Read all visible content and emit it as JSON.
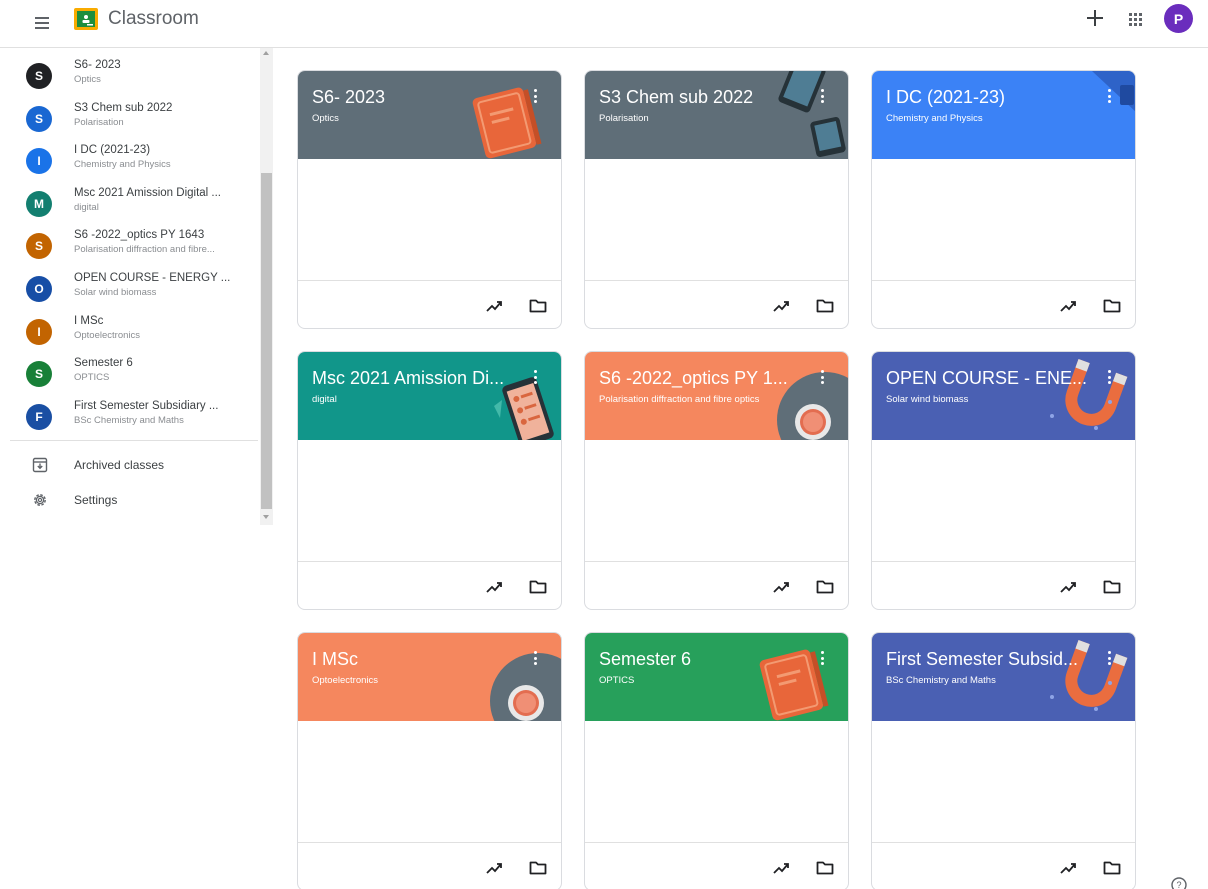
{
  "header": {
    "title": "Classroom",
    "avatar_letter": "P",
    "avatar_color": "#6a2dbd"
  },
  "sidebar": {
    "items": [
      {
        "initial": "S",
        "name": "S6- 2023",
        "subtitle": "Optics",
        "color": "#202124"
      },
      {
        "initial": "S",
        "name": "S3 Chem sub 2022",
        "subtitle": "Polarisation",
        "color": "#1967d2"
      },
      {
        "initial": "I",
        "name": "I DC (2021-23)",
        "subtitle": "Chemistry and Physics",
        "color": "#1a73e8"
      },
      {
        "initial": "M",
        "name": "Msc 2021 Amission Digital ...",
        "subtitle": "digital",
        "color": "#137f70"
      },
      {
        "initial": "S",
        "name": "S6 -2022_optics PY 1643",
        "subtitle": "Polarisation diffraction and fibre...",
        "color": "#c26401"
      },
      {
        "initial": "O",
        "name": "OPEN COURSE - ENERGY ...",
        "subtitle": "Solar wind biomass",
        "color": "#174ea6"
      },
      {
        "initial": "I",
        "name": "I MSc",
        "subtitle": "Optoelectronics",
        "color": "#c26401"
      },
      {
        "initial": "S",
        "name": "Semester 6",
        "subtitle": "OPTICS",
        "color": "#188038"
      },
      {
        "initial": "F",
        "name": "First Semester Subsidiary ...",
        "subtitle": "BSc Chemistry and Maths",
        "color": "#1a4fa3"
      }
    ],
    "archived_label": "Archived classes",
    "settings_label": "Settings"
  },
  "cards": [
    {
      "title": "S6- 2023",
      "subtitle": "Optics",
      "color": "#5f6e78",
      "icon": "book-icon"
    },
    {
      "title": "S3 Chem sub 2022",
      "subtitle": "Polarisation",
      "color": "#5f6e78",
      "icon": "devices-icon"
    },
    {
      "title": "I DC (2021-23)",
      "subtitle": "Chemistry and Physics",
      "color": "#3b82f6",
      "icon": "science-icon"
    },
    {
      "title": "Msc 2021 Amission Di...",
      "subtitle": "digital",
      "color": "#11968a",
      "icon": "phone-icon"
    },
    {
      "title": "S6 -2022_optics PY 1...",
      "subtitle": "Polarisation diffraction and fibre optics",
      "color": "#f5875e",
      "icon": "petri-dish-icon"
    },
    {
      "title": "OPEN COURSE - ENE...",
      "subtitle": "Solar wind biomass",
      "color": "#4a60b3",
      "icon": "magnet-icon"
    },
    {
      "title": "I MSc",
      "subtitle": "Optoelectronics",
      "color": "#f5875e",
      "icon": "petri-dish-icon"
    },
    {
      "title": "Semester 6",
      "subtitle": "OPTICS",
      "color": "#27a05b",
      "icon": "book-icon"
    },
    {
      "title": "First Semester Subsid...",
      "subtitle": "BSc Chemistry and Maths",
      "color": "#4a60b3",
      "icon": "magnet-icon"
    }
  ]
}
